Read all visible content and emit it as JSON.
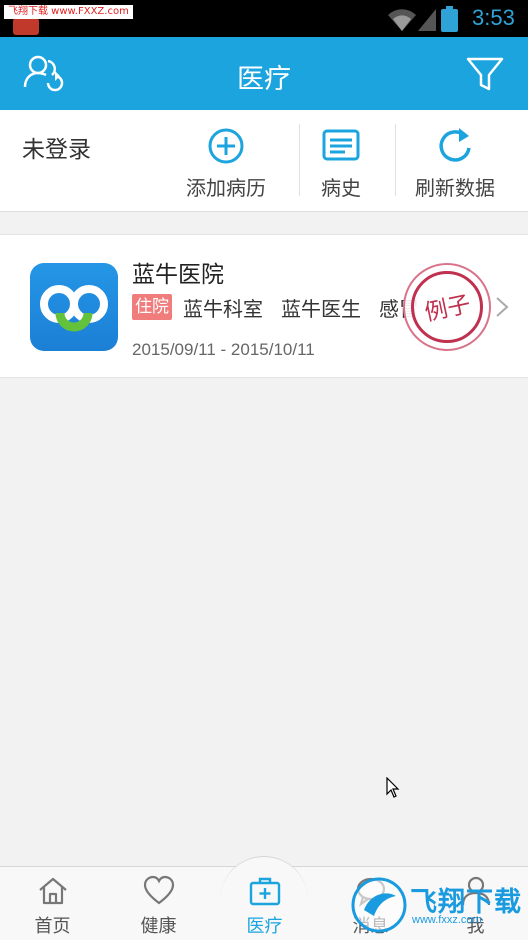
{
  "status_bar": {
    "watermark": "飞翔下载 www.FXXZ.com",
    "time": "3:53"
  },
  "header": {
    "title": "医疗"
  },
  "toolbar": {
    "login_status": "未登录",
    "add_label": "添加病历",
    "history_label": "病史",
    "refresh_label": "刷新数据"
  },
  "record": {
    "hospital": "蓝牛医院",
    "type_tag": "住院",
    "department": "蓝牛科室",
    "doctor": "蓝牛医生",
    "diagnosis": "感冒",
    "date_range": "2015/09/11 - 2015/10/11",
    "stamp": "例子"
  },
  "nav": {
    "items": [
      {
        "label": "首页",
        "icon": "home-icon"
      },
      {
        "label": "健康",
        "icon": "heart-icon"
      },
      {
        "label": "医疗",
        "icon": "medical-kit-icon",
        "active": true
      },
      {
        "label": "消息",
        "icon": "message-icon"
      },
      {
        "label": "我",
        "icon": "person-icon"
      }
    ]
  },
  "watermark_site": {
    "brand": "飞翔下载",
    "url": "www.fxxz.com"
  },
  "colors": {
    "primary": "#1ba4de",
    "tag": "#f07c7c",
    "stamp": "#c0304f"
  }
}
